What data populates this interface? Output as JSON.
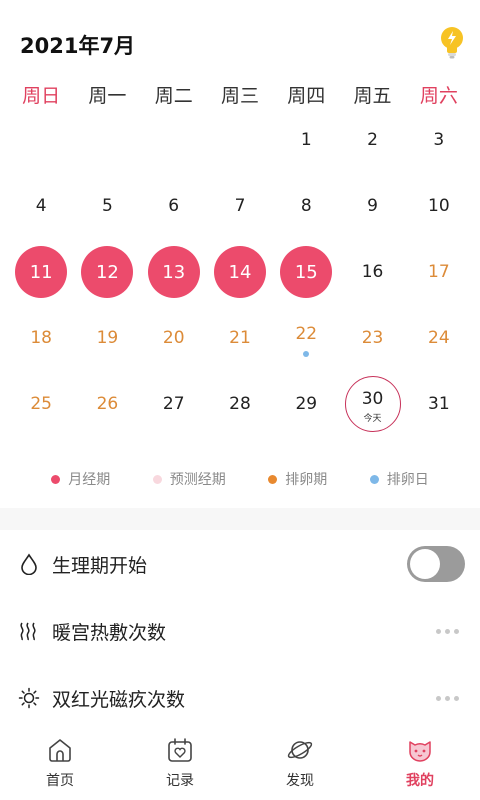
{
  "header": {
    "month_title": "2021年7月",
    "bulb_icon": "lightbulb-icon"
  },
  "weekdays": [
    "周日",
    "周一",
    "周二",
    "周三",
    "周四",
    "周五",
    "周六"
  ],
  "calendar": {
    "days": [
      {
        "n": "",
        "type": "empty"
      },
      {
        "n": "",
        "type": "empty"
      },
      {
        "n": "",
        "type": "empty"
      },
      {
        "n": "",
        "type": "empty"
      },
      {
        "n": "1",
        "type": "normal"
      },
      {
        "n": "2",
        "type": "normal"
      },
      {
        "n": "3",
        "type": "normal"
      },
      {
        "n": "4",
        "type": "normal"
      },
      {
        "n": "5",
        "type": "normal"
      },
      {
        "n": "6",
        "type": "normal"
      },
      {
        "n": "7",
        "type": "normal"
      },
      {
        "n": "8",
        "type": "normal"
      },
      {
        "n": "9",
        "type": "normal"
      },
      {
        "n": "10",
        "type": "normal"
      },
      {
        "n": "11",
        "type": "period"
      },
      {
        "n": "12",
        "type": "period"
      },
      {
        "n": "13",
        "type": "period"
      },
      {
        "n": "14",
        "type": "period"
      },
      {
        "n": "15",
        "type": "period"
      },
      {
        "n": "16",
        "type": "normal"
      },
      {
        "n": "17",
        "type": "fertile"
      },
      {
        "n": "18",
        "type": "fertile"
      },
      {
        "n": "19",
        "type": "fertile"
      },
      {
        "n": "20",
        "type": "fertile"
      },
      {
        "n": "21",
        "type": "fertile"
      },
      {
        "n": "22",
        "type": "ovulation"
      },
      {
        "n": "23",
        "type": "fertile"
      },
      {
        "n": "24",
        "type": "fertile"
      },
      {
        "n": "25",
        "type": "fertile"
      },
      {
        "n": "26",
        "type": "fertile"
      },
      {
        "n": "27",
        "type": "normal"
      },
      {
        "n": "28",
        "type": "normal"
      },
      {
        "n": "29",
        "type": "normal"
      },
      {
        "n": "30",
        "type": "today",
        "sub": "今天"
      },
      {
        "n": "31",
        "type": "normal"
      }
    ]
  },
  "legend": [
    {
      "label": "月经期",
      "color": "#ec4b6c"
    },
    {
      "label": "预测经期",
      "color": "#f8d8de"
    },
    {
      "label": "排卵期",
      "color": "#e8892f"
    },
    {
      "label": "排卵日",
      "color": "#7eb8e8"
    }
  ],
  "rows": [
    {
      "label": "生理期开始",
      "icon": "droplet-icon",
      "control": "toggle",
      "state": "off"
    },
    {
      "label": "暖宫热敷次数",
      "icon": "heat-waves-icon",
      "control": "more"
    },
    {
      "label": "双红光磁疚次数",
      "icon": "sun-icon",
      "control": "more"
    }
  ],
  "tabs": [
    {
      "label": "首页",
      "icon": "home-icon",
      "active": false
    },
    {
      "label": "记录",
      "icon": "calendar-heart-icon",
      "active": false
    },
    {
      "label": "发现",
      "icon": "planet-icon",
      "active": false
    },
    {
      "label": "我的",
      "icon": "cat-face-icon",
      "active": true
    }
  ],
  "colors": {
    "accent": "#e0415f",
    "period": "#ec4b6c",
    "fertile": "#dc8b38",
    "ovulation": "#7eb8e8"
  }
}
